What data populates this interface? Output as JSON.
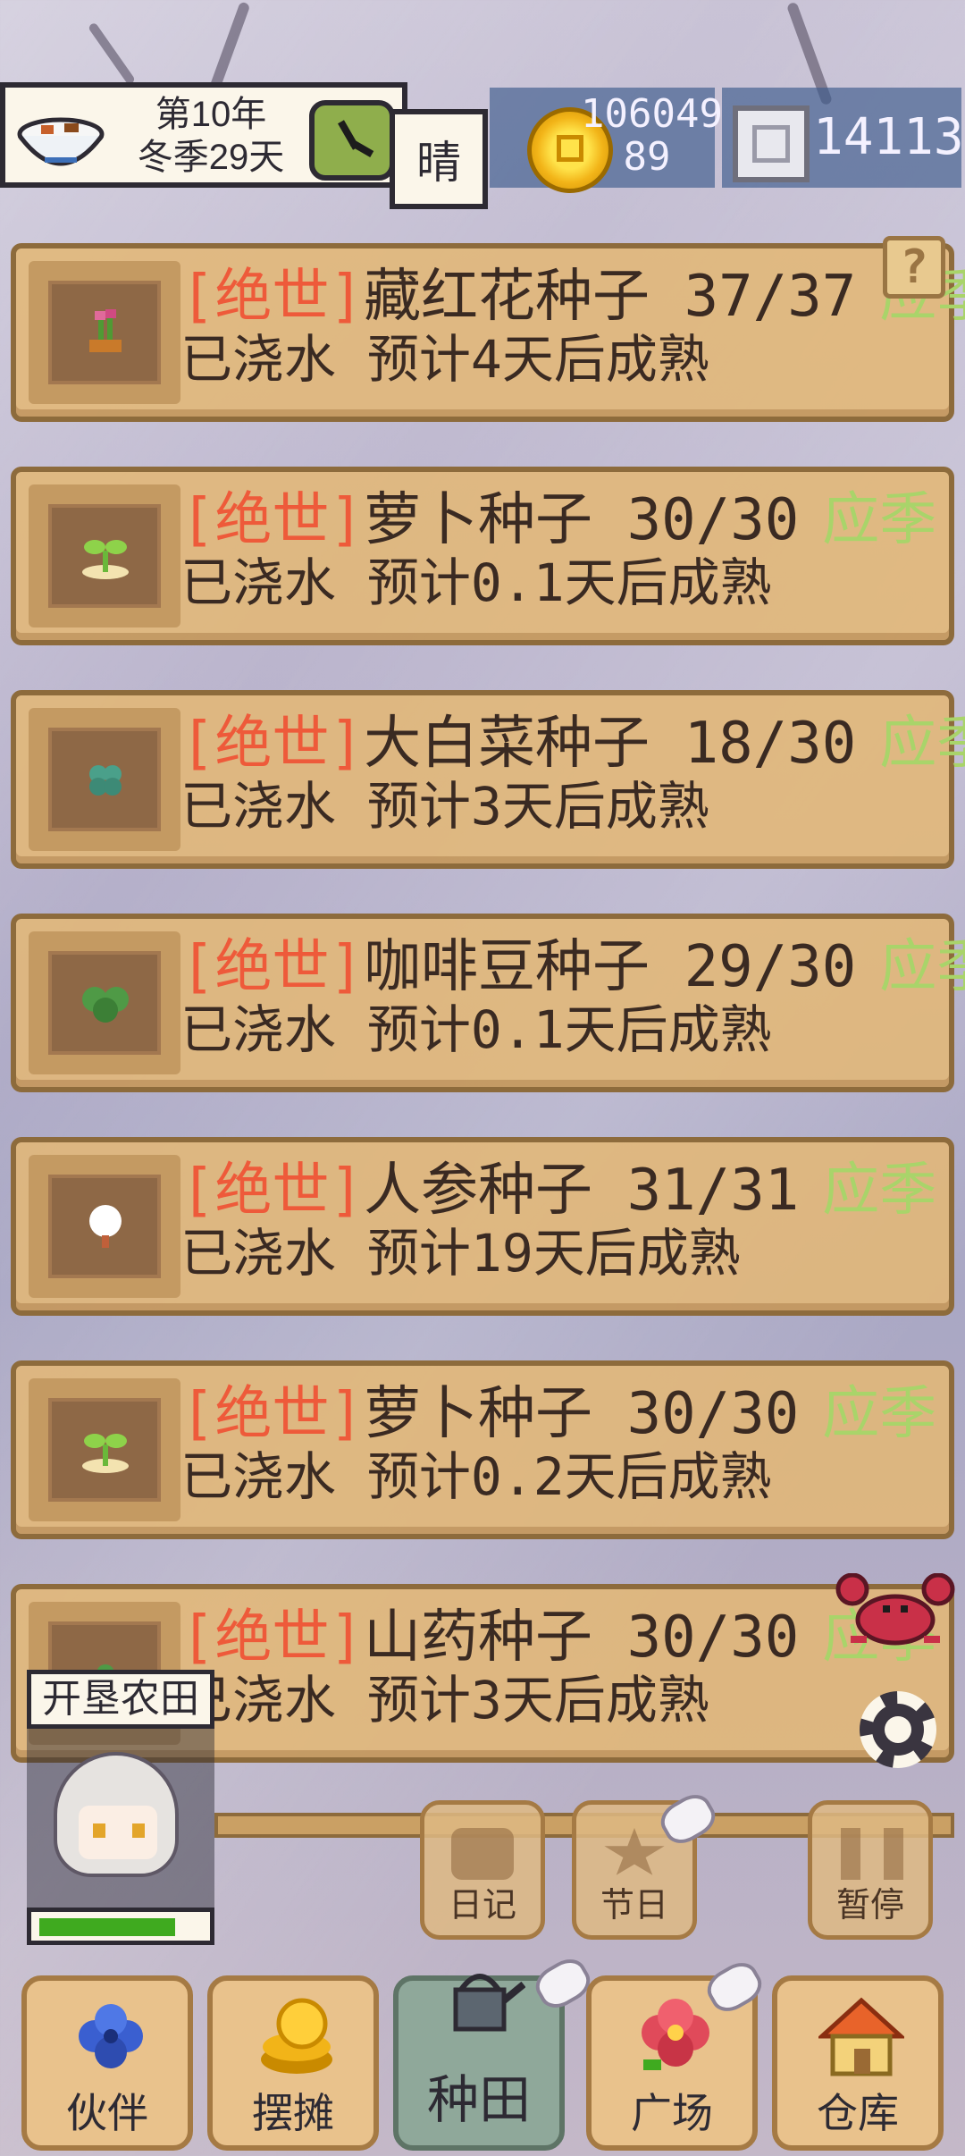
{
  "hud": {
    "date_line1": "第10年",
    "date_line2": "冬季29天",
    "weather": "晴",
    "coins": "106049\n89",
    "coins_line1": "106049",
    "coins_line2": "89",
    "gems": "14113"
  },
  "seeds": [
    {
      "rarity": "[绝世]",
      "name": "藏红花种子",
      "count": "37/37",
      "season": "应季",
      "status": "已浇水 预计4天后成熟",
      "icon": "saffron-sprout-icon"
    },
    {
      "rarity": "[绝世]",
      "name": "萝卜种子",
      "count": "30/30",
      "season": "应季",
      "status": "已浇水 预计0.1天后成熟",
      "icon": "seedling-icon"
    },
    {
      "rarity": "[绝世]",
      "name": "大白菜种子",
      "count": "18/30",
      "season": "应季",
      "status": "已浇水 预计3天后成熟",
      "icon": "sprout-icon"
    },
    {
      "rarity": "[绝世]",
      "name": "咖啡豆种子",
      "count": "29/30",
      "season": "应季",
      "status": "已浇水 预计0.1天后成熟",
      "icon": "bush-icon"
    },
    {
      "rarity": "[绝世]",
      "name": "人参种子",
      "count": "31/31",
      "season": "应季",
      "status": "已浇水 预计19天后成熟",
      "icon": "ginseng-icon"
    },
    {
      "rarity": "[绝世]",
      "name": "萝卜种子",
      "count": "30/30",
      "season": "应季",
      "status": "已浇水 预计0.2天后成熟",
      "icon": "seedling-icon"
    },
    {
      "rarity": "[绝世]",
      "name": "山药种子",
      "count": "30/30",
      "season": "应季",
      "status": "已浇水 预计3天后成熟",
      "icon": "yam-sprout-icon"
    }
  ],
  "help": "?",
  "farm_label": "开垦农田",
  "character": {
    "stamina": 0.8
  },
  "actions": {
    "diary": "日记",
    "festival": "节日",
    "pause": "暂停"
  },
  "nav": {
    "partner": "伙伴",
    "stall": "摆摊",
    "farming": "种田",
    "plaza": "广场",
    "warehouse": "仓库"
  },
  "colors": {
    "rarity": "#ee5a3a",
    "season": "#a9d46a",
    "panel": "#e2b776",
    "stamina": "#3faa1f"
  }
}
